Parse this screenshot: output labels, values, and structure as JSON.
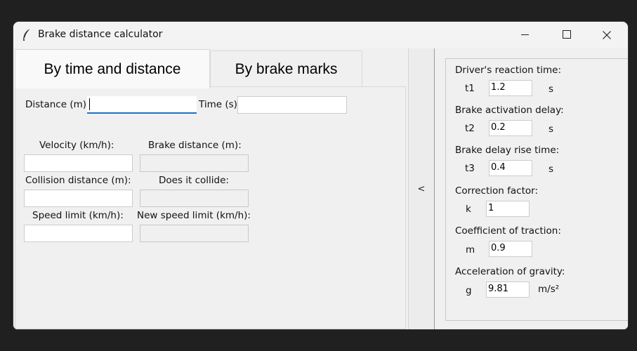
{
  "window": {
    "title": "Brake distance calculator",
    "icon": "feather-icon"
  },
  "tabs": [
    {
      "label": "By time and distance",
      "selected": true
    },
    {
      "label": "By brake marks",
      "selected": false
    }
  ],
  "form": {
    "distance_label": "Distance (m)",
    "distance_value": "",
    "time_label": "Time (s)",
    "time_value": "",
    "velocity_label": "Velocity (km/h):",
    "velocity_value": "",
    "brake_distance_label": "Brake distance (m):",
    "brake_distance_value": "",
    "collision_distance_label": "Collision distance (m):",
    "collision_distance_value": "",
    "does_collide_label": "Does it collide:",
    "does_collide_value": "",
    "speed_limit_label": "Speed limit (km/h):",
    "speed_limit_value": "",
    "new_speed_limit_label": "New speed limit (km/h):",
    "new_speed_limit_value": ""
  },
  "collapse_button": "<",
  "params": [
    {
      "label": "Driver's reaction time:",
      "symbol": "t1",
      "value": "1.2",
      "unit": "s"
    },
    {
      "label": "Brake activation delay:",
      "symbol": "t2",
      "value": "0.2",
      "unit": "s"
    },
    {
      "label": "Brake delay rise time:",
      "symbol": "t3",
      "value": "0.4",
      "unit": "s"
    },
    {
      "label": "Correction factor:",
      "symbol": "k",
      "value": "1",
      "unit": ""
    },
    {
      "label": "Coefficient of traction:",
      "symbol": "m",
      "value": "0.9",
      "unit": ""
    },
    {
      "label": "Acceleration of gravity:",
      "symbol": "g",
      "value": "9.81",
      "unit": "m/s²"
    }
  ],
  "colors": {
    "focus_underline": "#1f6fc5",
    "backdrop": "#202020"
  }
}
